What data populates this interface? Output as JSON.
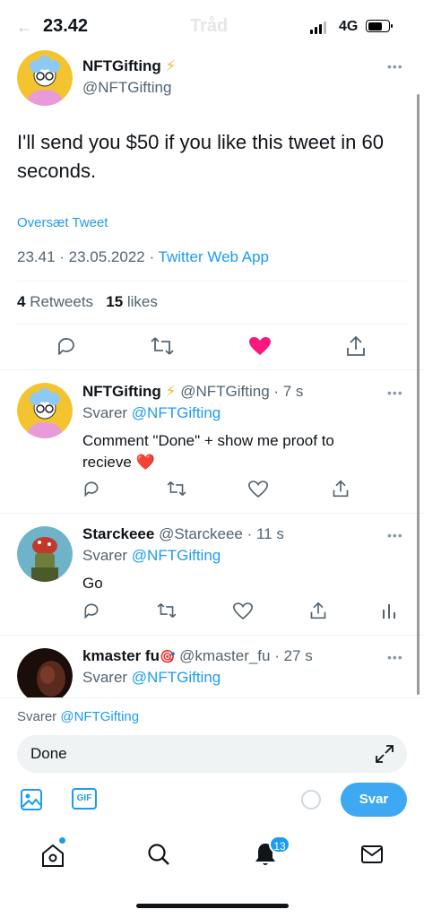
{
  "status": {
    "back": "←",
    "time": "23.42",
    "faded_title": "Tråd",
    "network": "4G"
  },
  "main_tweet": {
    "name": "NFTGifting",
    "verified_emoji": "⚡",
    "handle": "@NFTGifting",
    "text": "I'll send you $50 if you like this tweet in 60 seconds.",
    "translate": "Oversæt Tweet",
    "time": "23.41 · 23.05.2022 · ",
    "app": "Twitter Web App",
    "retweets_count": "4",
    "retweets_label": " Retweets",
    "likes_count": "15",
    "likes_label": " likes",
    "liked": true,
    "like_color": "#f91880"
  },
  "replies": [
    {
      "name": "NFTGifting",
      "emoji": "⚡",
      "handle": " @NFTGifting · 7 s",
      "replying_label": "Svarer ",
      "replying_to": "@NFTGifting",
      "text": "Comment \"Done\" + show me proof to recieve ❤️"
    },
    {
      "name": "Starckeee",
      "emoji": "",
      "handle": " @Starckeee · 11 s",
      "replying_label": "Svarer ",
      "replying_to": "@NFTGifting",
      "text": "Go"
    },
    {
      "name": "kmaster fu",
      "emoji": "🎯",
      "handle": " @kmaster_fu · 27 s",
      "replying_label": "Svarer ",
      "replying_to": "@NFTGifting"
    }
  ],
  "compose": {
    "replying_label": "Svarer ",
    "replying_to": "@NFTGifting",
    "value": "Done",
    "gif_label": "GIF",
    "reply_button": "Svar"
  },
  "tabbar": {
    "notifications_badge": "13"
  },
  "colors": {
    "accent": "#1d9bf0",
    "like": "#f91880",
    "secondary_text": "#536471"
  }
}
